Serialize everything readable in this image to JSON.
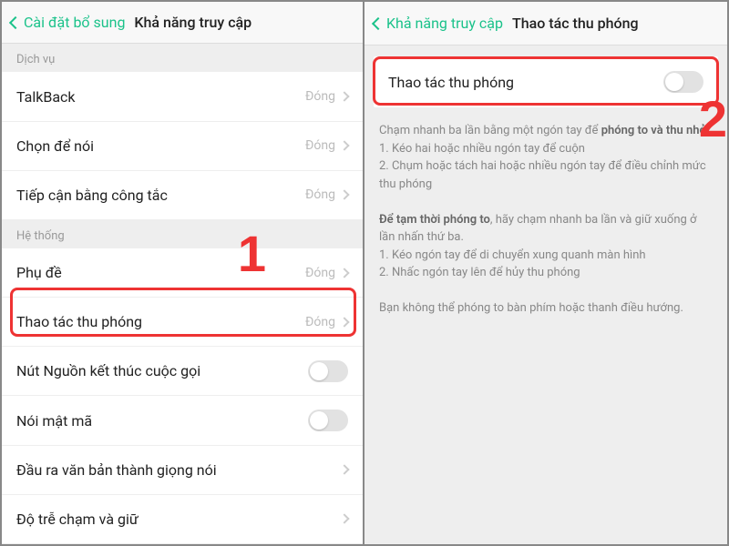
{
  "left": {
    "back": "Cài đặt bổ sung",
    "title": "Khả năng truy cập",
    "section1": "Dịch vụ",
    "section2": "Hệ thống",
    "closed": "Đóng",
    "rows": {
      "talkback": "TalkBack",
      "select_speak": "Chọn để nói",
      "switch_access": "Tiếp cận bằng công tắc",
      "captions": "Phụ đề",
      "zoom": "Thao tác thu phóng",
      "power_end": "Nút Nguồn kết thúc cuộc gọi",
      "speak_pw": "Nói mật mã",
      "tts": "Đầu ra văn bản thành giọng nói",
      "touch_hold": "Độ trễ chạm và giữ"
    },
    "step": "1"
  },
  "right": {
    "back": "Khả năng truy cập",
    "title": "Thao tác thu phóng",
    "toggle_label": "Thao tác thu phóng",
    "desc1a": "Chạm nhanh ba lần bằng một ngón tay để ",
    "desc1b": "phóng to và thu nhỏ",
    "desc1c": ".",
    "line1": "1. Kéo hai hoặc nhiều ngón tay để cuộn",
    "line2": "2. Chụm hoặc tách hai hoặc nhiều ngón tay để điều chỉnh mức thu phóng",
    "desc2a": "Để tạm thời phóng to",
    "desc2b": ", hãy chạm nhanh ba lần và giữ xuống ở lần nhấn thứ ba.",
    "line3": "1. Kéo ngón tay để di chuyển xung quanh màn hình",
    "line4": "2. Nhấc ngón tay lên để hủy thu phóng",
    "note": "Bạn không thể phóng to bàn phím hoặc thanh điều hướng.",
    "step": "2"
  }
}
